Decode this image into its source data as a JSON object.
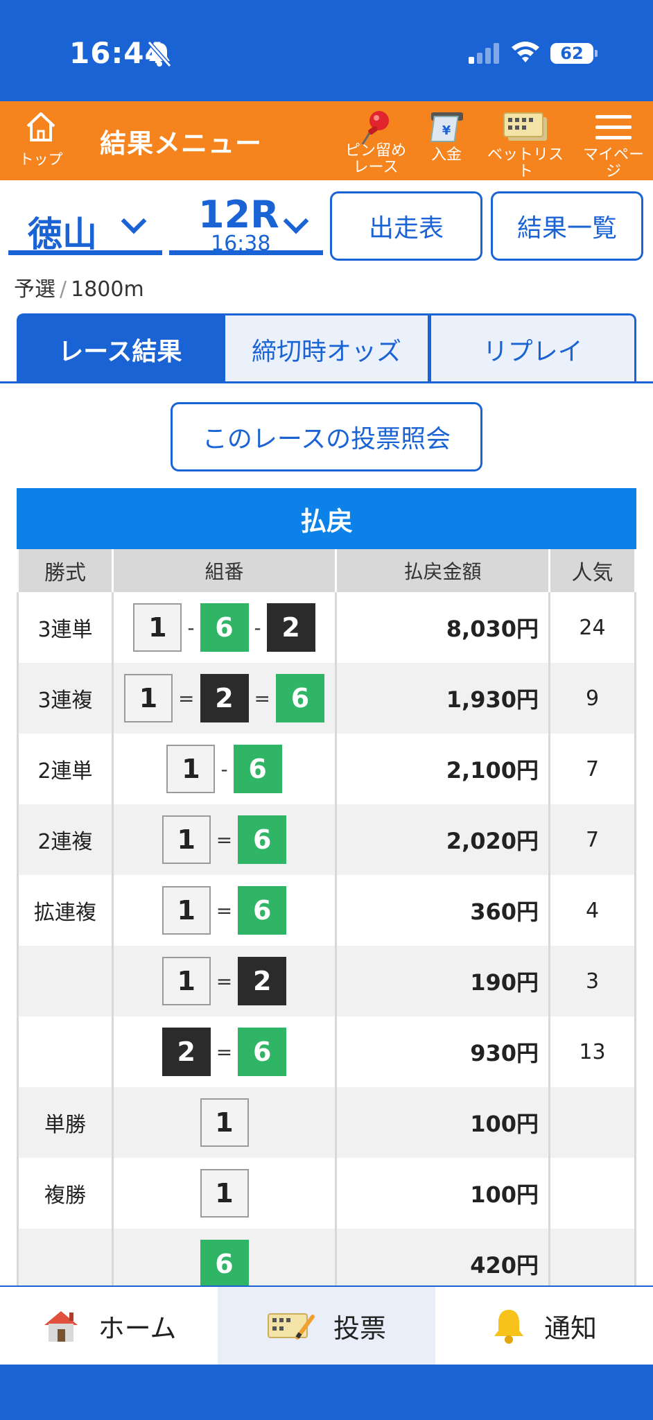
{
  "status_bar": {
    "time": "16:44",
    "battery": "62"
  },
  "header": {
    "home_label": "トップ",
    "title": "結果メニュー",
    "items": [
      {
        "label": "ピン留め\nレース",
        "icon": "pin-icon"
      },
      {
        "label": "入金",
        "icon": "deposit-icon"
      },
      {
        "label": "ベットリスト",
        "icon": "bet-list-icon"
      },
      {
        "label": "マイページ",
        "icon": "hamburger-menu-icon"
      }
    ]
  },
  "venue": {
    "name": "徳山",
    "race": "12R",
    "race_time": "16:38"
  },
  "buttons": {
    "entry_table": "出走表",
    "results_list": "結果一覧",
    "inquiry": "このレースの投票照会"
  },
  "race_info": {
    "category": "予選",
    "distance": "1800m"
  },
  "tabs": [
    {
      "label": "レース結果",
      "active": true
    },
    {
      "label": "締切時オッズ",
      "active": false
    },
    {
      "label": "リプレイ",
      "active": false
    }
  ],
  "payout": {
    "title": "払戻",
    "headers": [
      "勝式",
      "組番",
      "払戻金額",
      "人気"
    ],
    "rows": [
      {
        "type": "3連単",
        "combo": [
          "1",
          "6",
          "2"
        ],
        "op": "-",
        "amount": "8,030円",
        "pop": "24"
      },
      {
        "type": "3連複",
        "combo": [
          "1",
          "2",
          "6"
        ],
        "op": "=",
        "amount": "1,930円",
        "pop": "9"
      },
      {
        "type": "2連単",
        "combo": [
          "1",
          "6"
        ],
        "op": "-",
        "amount": "2,100円",
        "pop": "7"
      },
      {
        "type": "2連複",
        "combo": [
          "1",
          "6"
        ],
        "op": "=",
        "amount": "2,020円",
        "pop": "7"
      },
      {
        "type": "拡連複",
        "combo": [
          "1",
          "6"
        ],
        "op": "=",
        "amount": "360円",
        "pop": "4"
      },
      {
        "type": "",
        "combo": [
          "1",
          "2"
        ],
        "op": "=",
        "amount": "190円",
        "pop": "3"
      },
      {
        "type": "",
        "combo": [
          "2",
          "6"
        ],
        "op": "=",
        "amount": "930円",
        "pop": "13"
      },
      {
        "type": "単勝",
        "combo": [
          "1"
        ],
        "op": "",
        "amount": "100円",
        "pop": ""
      },
      {
        "type": "複勝",
        "combo": [
          "1"
        ],
        "op": "",
        "amount": "100円",
        "pop": ""
      },
      {
        "type": "",
        "combo": [
          "6"
        ],
        "op": "",
        "amount": "420円",
        "pop": ""
      }
    ]
  },
  "bottom_nav": [
    {
      "label": "ホーム",
      "icon": "house-icon",
      "active": false
    },
    {
      "label": "投票",
      "icon": "ticket-pen-icon",
      "active": true
    },
    {
      "label": "通知",
      "icon": "bell-icon",
      "active": false
    }
  ],
  "colors": {
    "primary": "#1a63d4",
    "header_orange": "#f5841f",
    "payout_blue": "#0c82e8",
    "boat_white": "#f3f3f3",
    "boat_black": "#2b2b2b",
    "boat_green": "#2fb565"
  }
}
